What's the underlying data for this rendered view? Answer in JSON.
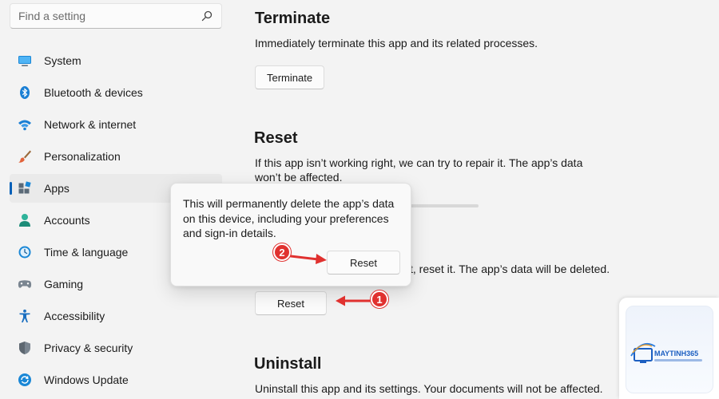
{
  "search": {
    "placeholder": "Find a setting"
  },
  "sidebar": {
    "items": [
      {
        "label": "System",
        "icon": "system-icon"
      },
      {
        "label": "Bluetooth & devices",
        "icon": "bluetooth-icon"
      },
      {
        "label": "Network & internet",
        "icon": "wifi-icon"
      },
      {
        "label": "Personalization",
        "icon": "brush-icon"
      },
      {
        "label": "Apps",
        "icon": "apps-icon",
        "active": true
      },
      {
        "label": "Accounts",
        "icon": "person-icon"
      },
      {
        "label": "Time & language",
        "icon": "clock-globe-icon"
      },
      {
        "label": "Gaming",
        "icon": "gamepad-icon"
      },
      {
        "label": "Accessibility",
        "icon": "accessibility-icon"
      },
      {
        "label": "Privacy & security",
        "icon": "shield-icon"
      },
      {
        "label": "Windows Update",
        "icon": "update-icon"
      }
    ]
  },
  "terminate": {
    "title": "Terminate",
    "description": "Immediately terminate this app and its related processes.",
    "button": "Terminate"
  },
  "reset": {
    "title": "Reset",
    "repair_description_line1": "If this app isn’t working right, we can try to repair it. The app’s data",
    "repair_description_line2": "won’t be affected.",
    "reset_description_partial": "t, reset it. The app’s data will be deleted.",
    "button": "Reset"
  },
  "dialog": {
    "message": "This will permanently delete the app’s data on this device, including your preferences and sign-in details.",
    "confirm_button": "Reset"
  },
  "uninstall": {
    "title": "Uninstall",
    "description": "Uninstall this app and its settings. Your documents will not be affected."
  },
  "annotations": {
    "step1": "1",
    "step2": "2",
    "color": "#e0312f"
  },
  "watermark": {
    "brand": "MAYTINH365"
  },
  "colors": {
    "accent": "#005fb8",
    "background": "#f3f3f3"
  }
}
